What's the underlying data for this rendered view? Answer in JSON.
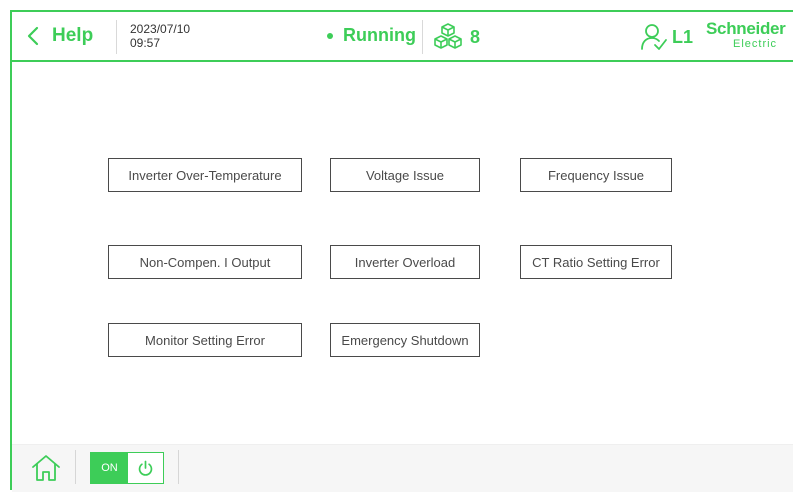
{
  "header": {
    "back_label": "Help",
    "date": "2023/07/10",
    "time": "09:57",
    "status": "Running",
    "module_count": "8",
    "user_level": "L1",
    "brand_line1": "Schneider",
    "brand_line2": "Electric"
  },
  "faults": [
    "Inverter Over-Temperature",
    "Voltage Issue",
    "Frequency Issue",
    "Non-Compen. I Output",
    "Inverter Overload",
    "CT Ratio Setting Error",
    "Monitor Setting Error",
    "Emergency Shutdown"
  ],
  "footer": {
    "toggle_label": "ON"
  },
  "colors": {
    "accent": "#3dcd58",
    "border": "#4a4a4a"
  },
  "icons": {
    "back": "chevron-left-icon",
    "modules": "cubes-icon",
    "user": "user-check-icon",
    "home": "home-icon",
    "power": "power-icon"
  }
}
